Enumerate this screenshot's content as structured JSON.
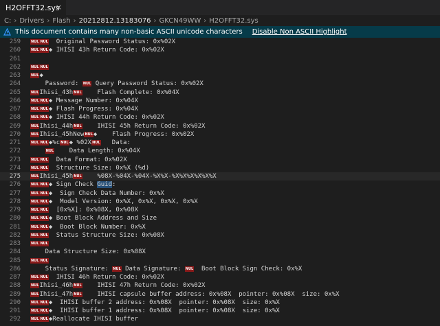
{
  "tab": {
    "filename": "H2OFFT32.sys",
    "close_glyph": "×"
  },
  "breadcrumb": [
    "C:",
    "Drivers",
    "Flash",
    "20212812.13183076",
    "GKCN49WW",
    "H2OFFT32.sys"
  ],
  "banner": {
    "message": "This document contains many non-basic ASCII unicode characters",
    "action": "Disable Non ASCII Highlight",
    "background": "#063b49"
  },
  "control_char_label": "NUL",
  "current_line": 275,
  "lines": [
    {
      "n": "259",
      "t": "[[NUL]][[NUL]]  Original Password Status: 0x%02X"
    },
    {
      "n": "260",
      "t": "[[NUL]][[NUL]]◆ IHISI 43h Return Code: 0x%02X"
    },
    {
      "n": "261",
      "t": ""
    },
    {
      "n": "262",
      "t": "[[NUL]][[NUL]]"
    },
    {
      "n": "263",
      "t": "[[NUL]]◆"
    },
    {
      "n": "264",
      "t": "    Password: [[NUL]] Query Password Status: 0x%02X"
    },
    {
      "n": "265",
      "t": "[[NUL]]Ihisi_43h[[NUL]]    Flash Complete: 0x%04X"
    },
    {
      "n": "266",
      "t": "[[NUL]][[NUL]]◆ Message Number: 0x%04X"
    },
    {
      "n": "267",
      "t": "[[NUL]][[NUL]]◆ Flash Progress: 0x%04X"
    },
    {
      "n": "268",
      "t": "[[NUL]][[NUL]]◆ IHISI 44h Return Code: 0x%02X"
    },
    {
      "n": "269",
      "t": "[[NUL]]Ihisi_44h[[NUL]]    IHISI 45h Return Code: 0x%02X"
    },
    {
      "n": "270",
      "t": "[[NUL]]Ihisi_45hNew[[NUL]]◆    Flash Progress: 0x%02X"
    },
    {
      "n": "271",
      "t": "[[NUL]][[NUL]]◆%c[[NUL]]◆ %02X[[NUL]]   Data:"
    },
    {
      "n": "272",
      "t": "    [[NUL]]    Data Length: 0x%04X"
    },
    {
      "n": "273",
      "t": "[[NUL]][[NUL]]  Data Format: 0x%02X"
    },
    {
      "n": "274",
      "t": "[[NUL]][[NUL]]  Structure Size: 0x%X (%d)"
    },
    {
      "n": "275",
      "t": "[[NUL]]Ihisi_45h[[NUL]]    %08X-%04X-%04X-%X%X-%X%X%X%X%X%X"
    },
    {
      "n": "276",
      "t": "[[NUL]][[NUL]]◆ Sign Check Guid:"
    },
    {
      "n": "277",
      "t": "[[NUL]][[NUL]]◆  Sign Check Data Number: 0x%X"
    },
    {
      "n": "278",
      "t": "[[NUL]][[NUL]]◆  Model Version: 0x%X, 0x%X, 0x%X, 0x%X"
    },
    {
      "n": "279",
      "t": "[[NUL]][[NUL]]  [0x%X]: 0x%08X, 0x%08X"
    },
    {
      "n": "280",
      "t": "[[NUL]][[NUL]]◆ Boot Block Address and Size"
    },
    {
      "n": "281",
      "t": "[[NUL]][[NUL]]◆  Boot Block Number: 0x%X"
    },
    {
      "n": "282",
      "t": "[[NUL]][[NUL]]  Status Structure Size: 0x%08X"
    },
    {
      "n": "283",
      "t": "[[NUL]][[NUL]]"
    },
    {
      "n": "284",
      "t": "    Data Structure Size: 0x%08X"
    },
    {
      "n": "285",
      "t": "[[NUL]][[NUL]]"
    },
    {
      "n": "286",
      "t": "    Status Signature: [[NUL]] Data Signature: [[NUL]]  Boot Block Sign Check: 0x%X"
    },
    {
      "n": "287",
      "t": "[[NUL]][[NUL]]  IHISI 46h Return Code: 0x%02X"
    },
    {
      "n": "288",
      "t": "[[NUL]]Ihisi_46h[[NUL]]    IHISI 47h Return Code: 0x%02X"
    },
    {
      "n": "289",
      "t": "[[NUL]]Ihisi_47h[[NUL]]    IHISI capsule buffer address: 0x%08X  pointer: 0x%08X  size: 0x%X"
    },
    {
      "n": "290",
      "t": "[[NUL]][[NUL]]◆  IHISI buffer 2 address: 0x%08X  pointer: 0x%08X  size: 0x%X"
    },
    {
      "n": "291",
      "t": "[[NUL]][[NUL]]◆  IHISI buffer 1 address: 0x%08X  pointer: 0x%08X  size: 0x%X"
    },
    {
      "n": "292",
      "t": "[[NUL]][[NUL]]◆Reallocate IHISI buffer"
    }
  ]
}
